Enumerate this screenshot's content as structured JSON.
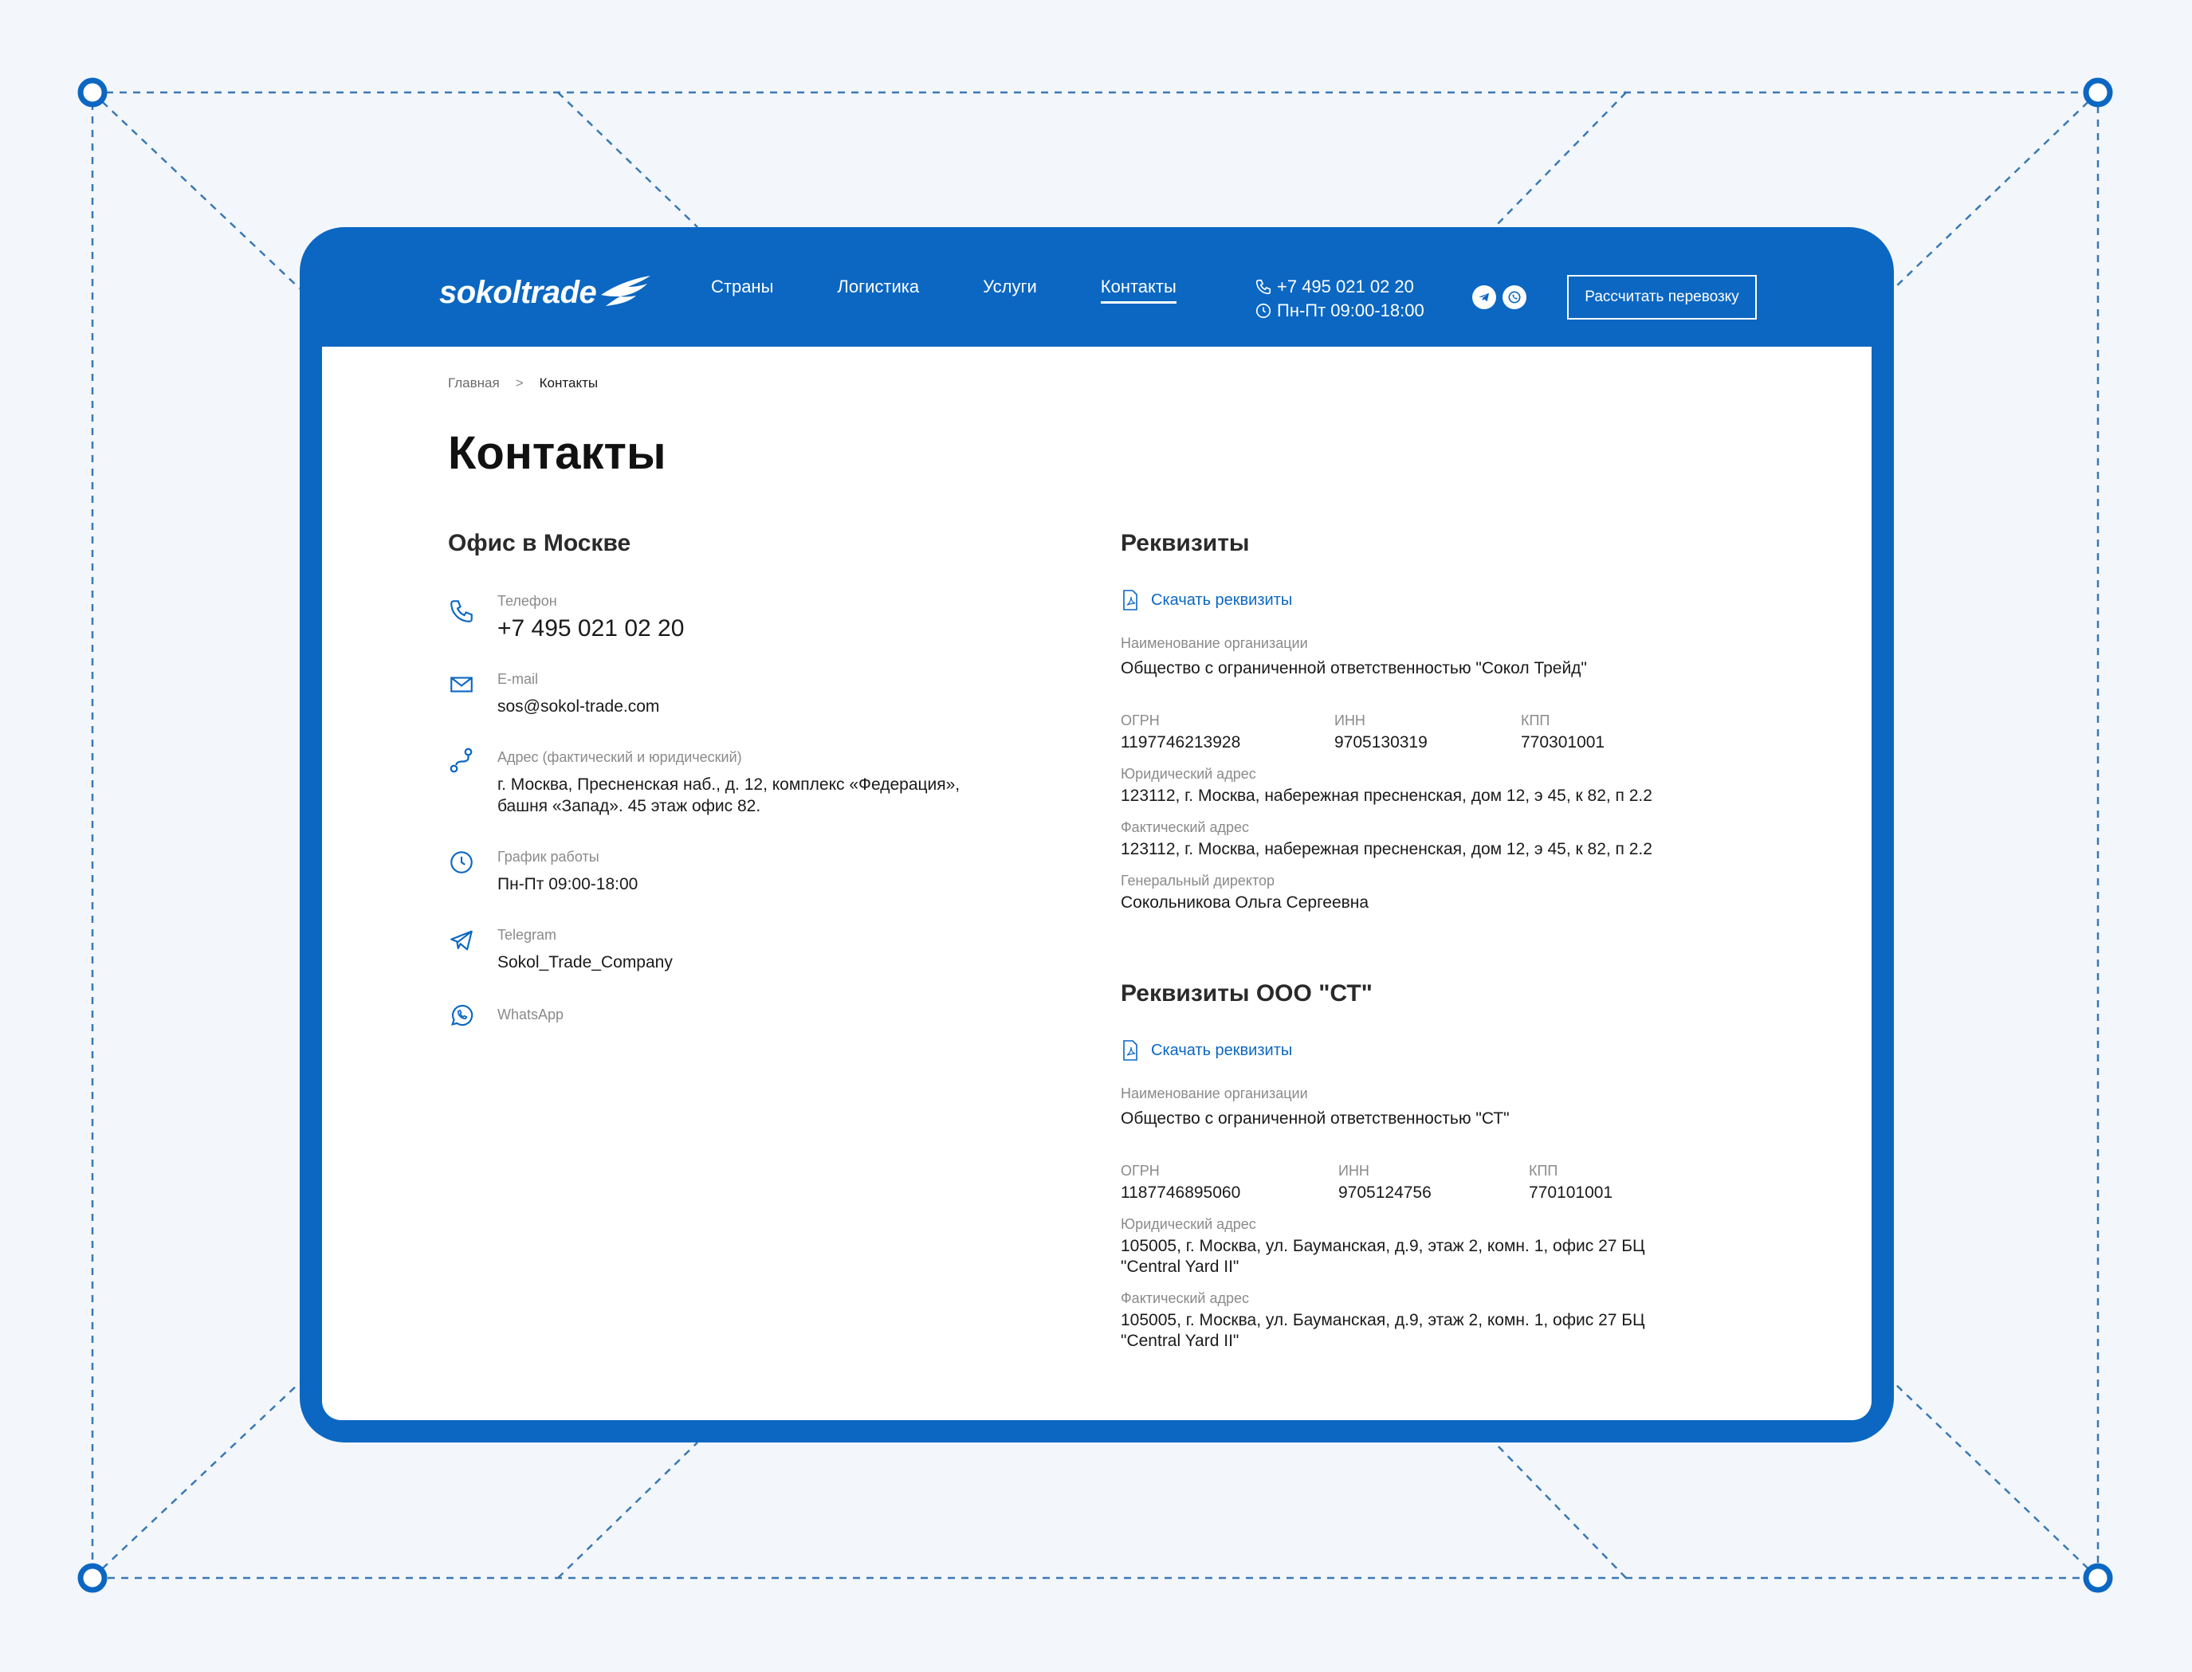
{
  "brand": {
    "logo_text": "sokoltrade"
  },
  "nav": {
    "items": [
      "Страны",
      "Логистика",
      "Услуги",
      "Контакты"
    ],
    "active": "Контакты"
  },
  "header": {
    "phone": "+7 495 021 02 20",
    "hours": "Пн-Пт 09:00-18:00",
    "social_icons": [
      "telegram-icon",
      "whatsapp-icon"
    ],
    "cta_label": "Рассчитать перевозку"
  },
  "breadcrumb": {
    "home": "Главная",
    "separator": ">",
    "current": "Контакты"
  },
  "page": {
    "title": "Контакты"
  },
  "office": {
    "title": "Офис в Москве",
    "items": [
      {
        "icon": "phone-icon",
        "label": "Телефон",
        "value": "+7 495 021 02 20"
      },
      {
        "icon": "mail-icon",
        "label": "E-mail",
        "value": "sos@sokol-trade.com"
      },
      {
        "icon": "route-icon",
        "label": "Адрес (фактический и юридический)",
        "value_line1": "г. Москва, Пресненская наб., д. 12, комплекс «Федерация»,",
        "value_line2": "башня «Запад». 45 этаж офис 82."
      },
      {
        "icon": "clock-icon",
        "label": "График работы",
        "value": "Пн-Пт 09:00-18:00"
      },
      {
        "icon": "telegram-icon",
        "label": "Telegram",
        "value": "Sokol_Trade_Company"
      },
      {
        "icon": "whatsapp-icon",
        "label": "WhatsApp"
      }
    ]
  },
  "requisites": [
    {
      "title": "Реквизиты",
      "download": "Скачать реквизиты",
      "org_label": "Наименование организации",
      "org_value": "Общество с ограниченной ответственностью \"Сокол Трейд\"",
      "ogrn_label": "ОГРН",
      "ogrn": "1197746213928",
      "inn_label": "ИНН",
      "inn": "9705130319",
      "kpp_label": "КПП",
      "kpp": "770301001",
      "legal_label": "Юридический адрес",
      "legal": "123112, г. Москва, набережная пресненская, дом 12, э 45, к 82, п 2.2",
      "actual_label": "Фактический адрес",
      "actual": "123112, г. Москва, набережная пресненская, дом 12, э 45, к 82, п 2.2",
      "director_label": "Генеральный директор",
      "director": "Сокольникова Ольга Сергеевна"
    },
    {
      "title": "Реквизиты ООО \"СТ\"",
      "download": "Скачать реквизиты",
      "org_label": "Наименование организации",
      "org_value": "Общество с ограниченной ответственностью \"СТ\"",
      "ogrn_label": "ОГРН",
      "ogrn": "1187746895060",
      "inn_label": "ИНН",
      "inn": "9705124756",
      "kpp_label": "КПП",
      "kpp": "770101001",
      "legal_label": "Юридический адрес",
      "legal_line1": "105005, г. Москва, ул. Бауманская, д.9, этаж 2, комн. 1, офис 27 БЦ",
      "legal_line2": "\"Central Yard II\"",
      "actual_label": "Фактический адрес",
      "actual_line1": "105005, г. Москва, ул. Бауманская, д.9, этаж 2, комн. 1, офис 27 БЦ",
      "actual_line2": "\"Central Yard II\""
    }
  ],
  "colors": {
    "brand_blue": "#0b67c2",
    "background": "#f3f7fb",
    "decor_line": "#2a6fb0"
  }
}
